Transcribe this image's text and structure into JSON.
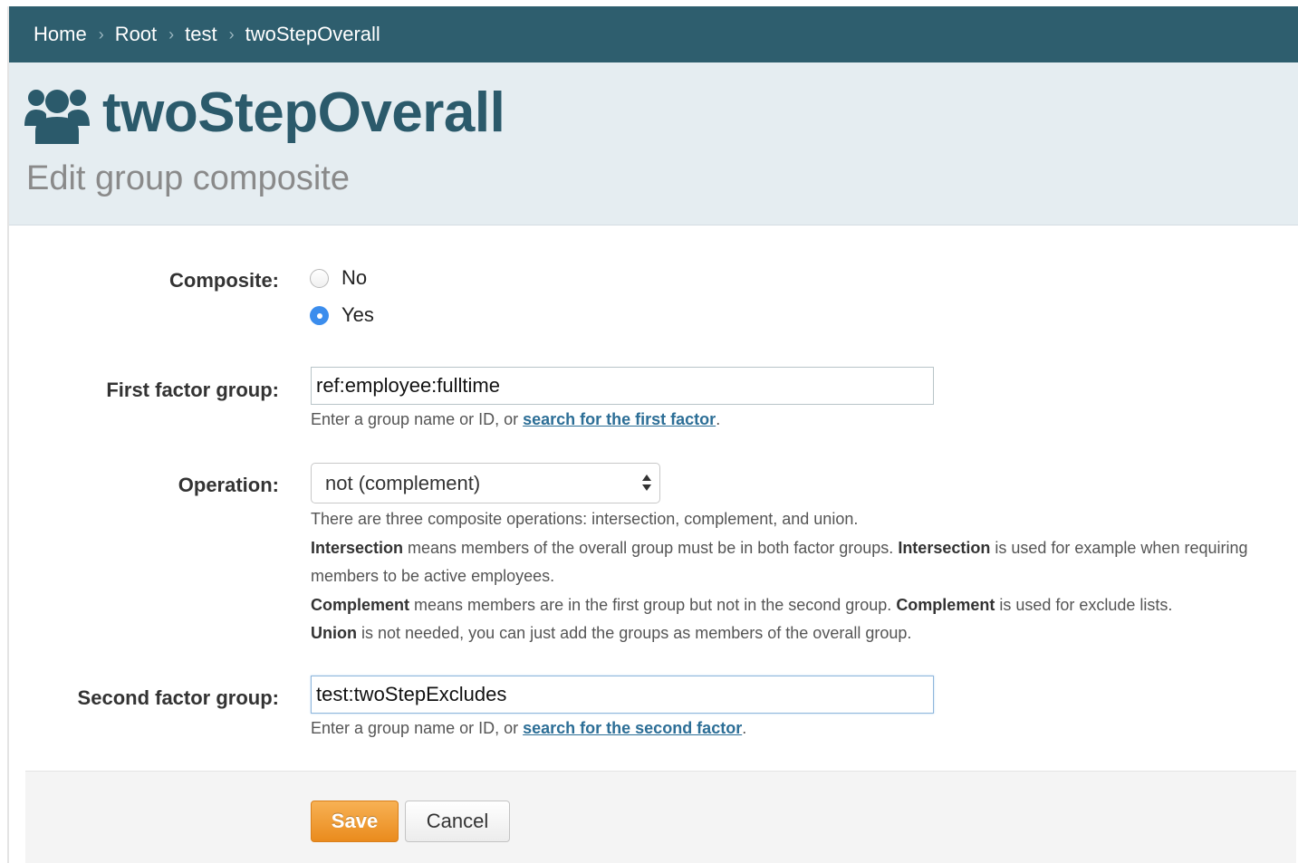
{
  "breadcrumb": {
    "items": [
      "Home",
      "Root",
      "test"
    ],
    "current": "twoStepOverall",
    "separator": "›"
  },
  "header": {
    "icon": "users-icon",
    "title": "twoStepOverall",
    "subtitle": "Edit group composite"
  },
  "form": {
    "composite": {
      "label": "Composite:",
      "options": [
        {
          "label": "No",
          "checked": false
        },
        {
          "label": "Yes",
          "checked": true
        }
      ]
    },
    "first_factor": {
      "label": "First factor group:",
      "value": "ref:employee:fulltime",
      "help_prefix": "Enter a group name or ID, or ",
      "help_link": "search for the first factor",
      "help_suffix": "."
    },
    "operation": {
      "label": "Operation:",
      "selected": "not (complement)",
      "description": {
        "line1": "There are three composite operations: intersection, complement, and union.",
        "intersection_term": "Intersection",
        "intersection_text": " means members of the overall group must be in both factor groups. ",
        "intersection_term2": "Intersection",
        "intersection_text2": " is used for example when requiring members to be active employees.",
        "complement_term": "Complement",
        "complement_text": " means members are in the first group but not in the second group. ",
        "complement_term2": "Complement",
        "complement_text2": " is used for exclude lists.",
        "union_term": "Union",
        "union_text": " is not needed, you can just add the groups as members of the overall group."
      }
    },
    "second_factor": {
      "label": "Second factor group:",
      "value": "test:twoStepExcludes",
      "help_prefix": "Enter a group name or ID, or ",
      "help_link": "search for the second factor",
      "help_suffix": "."
    }
  },
  "buttons": {
    "save": "Save",
    "cancel": "Cancel"
  },
  "colors": {
    "breadcrumb_bg": "#2e5e6e",
    "header_bg": "#e5edf1",
    "title": "#2b5a6b",
    "link": "#2c6e96",
    "save_button": "#ea8b1d",
    "radio_checked": "#3b8ded"
  }
}
